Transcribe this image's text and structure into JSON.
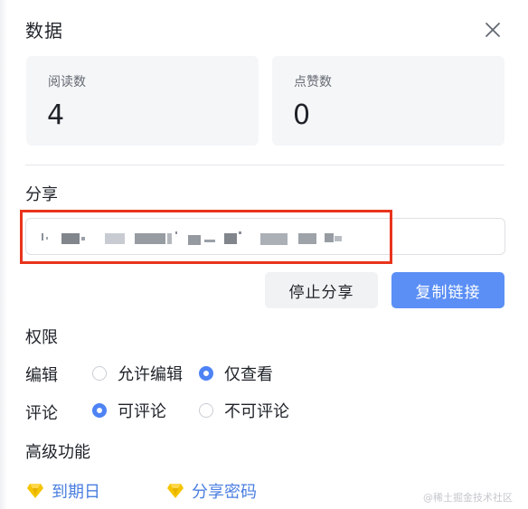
{
  "dialog": {
    "title": "数据"
  },
  "stats": {
    "read_label": "阅读数",
    "read_value": "4",
    "like_label": "点赞数",
    "like_value": "0"
  },
  "share": {
    "label": "分享",
    "stop_button": "停止分享",
    "copy_button": "复制链接"
  },
  "permissions": {
    "label": "权限",
    "edit_label": "编辑",
    "edit_options": [
      "允许编辑",
      "仅查看"
    ],
    "edit_selected": "仅查看",
    "comment_label": "评论",
    "comment_options": [
      "可评论",
      "不可评论"
    ],
    "comment_selected": "可评论"
  },
  "advanced": {
    "label": "高级功能",
    "features": [
      "到期日",
      "分享密码"
    ]
  },
  "watermark": "@稀土掘金技术社区",
  "colors": {
    "accent": "#5b8ff5",
    "radio_checked": "#4e83f5",
    "highlight_border": "#e8341c",
    "gem": "#f5c400"
  },
  "icons": {
    "close": "close-icon",
    "feature": "diamond-icon"
  }
}
